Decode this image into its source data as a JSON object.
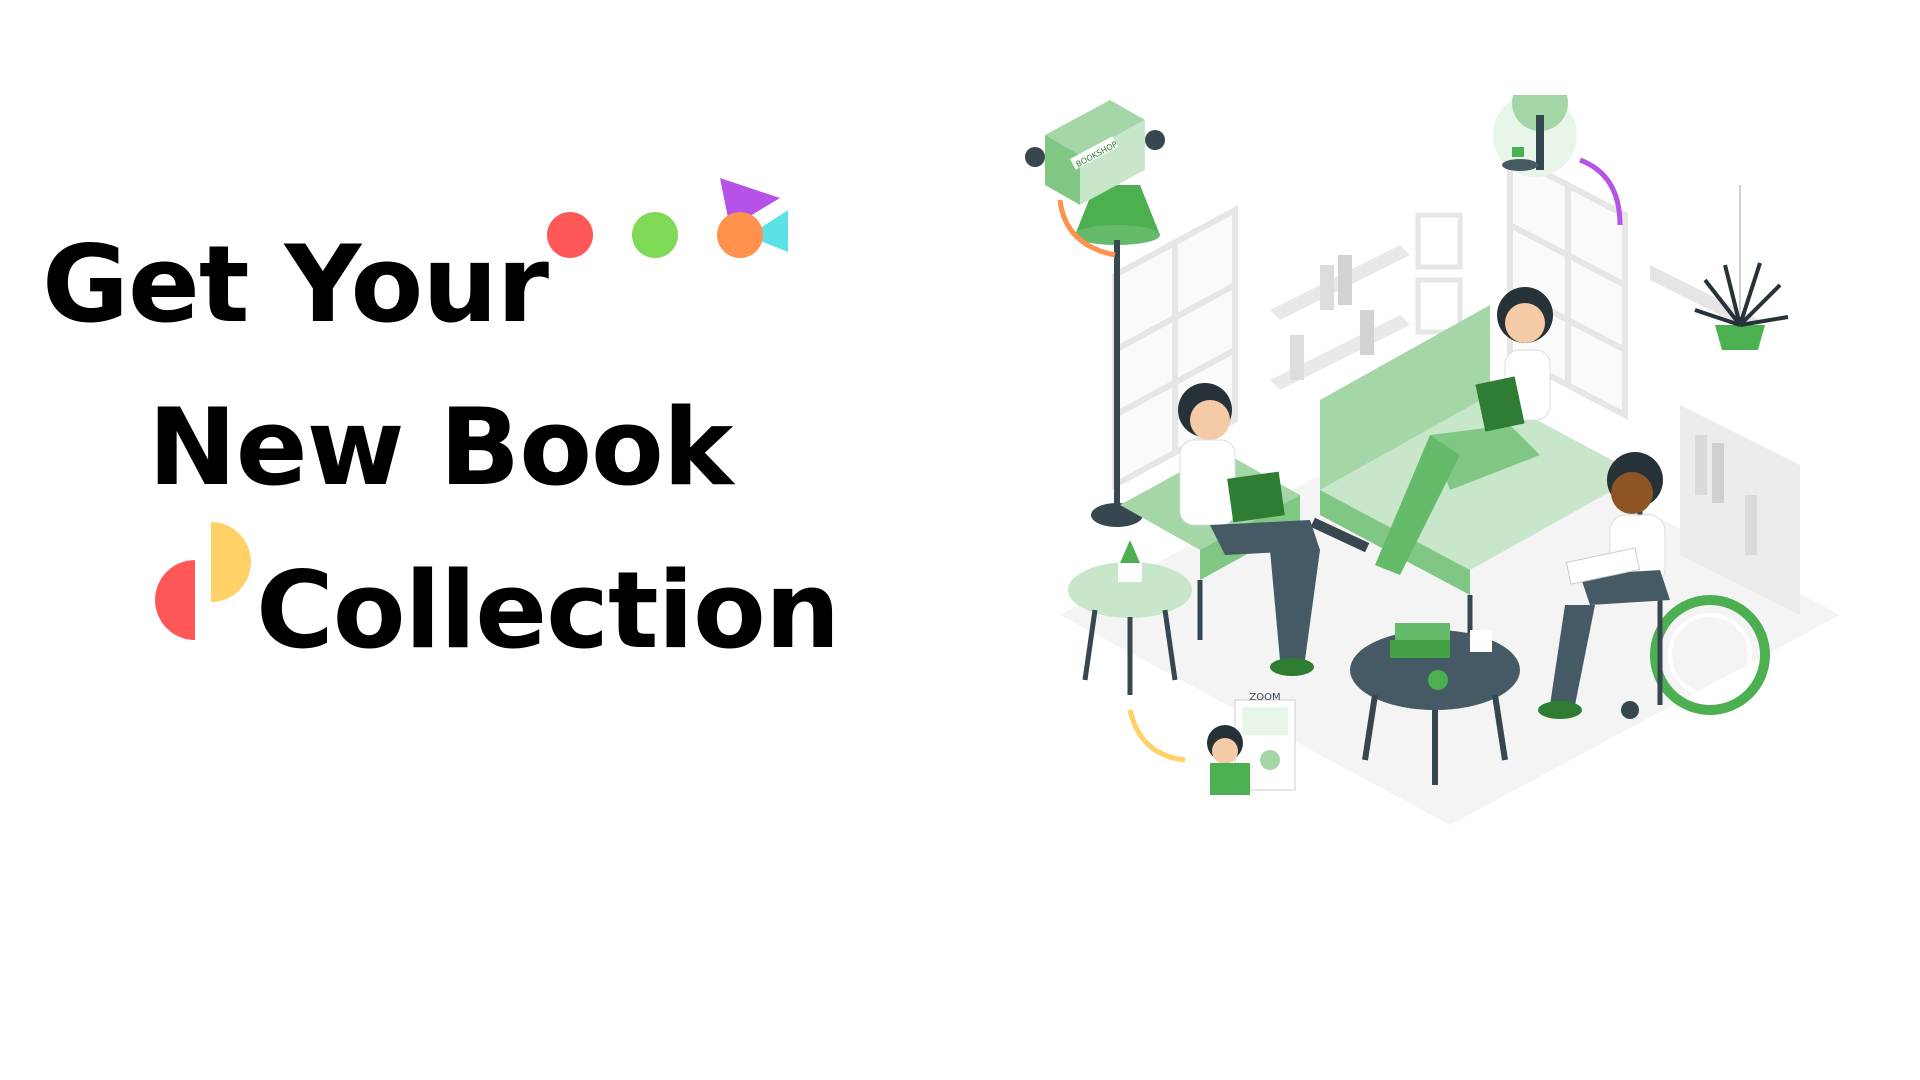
{
  "headline": {
    "line1": "Get Your",
    "line2": "New Book",
    "line3": "Collection"
  },
  "illustration": {
    "bookshop_sign": "BOOKSHOP",
    "comic_sign": "ZOOM"
  },
  "colors": {
    "text": "#000000",
    "accent_red": "#FF5757",
    "accent_green": "#7ED957",
    "accent_orange": "#FF914D",
    "accent_purple": "#B552E8",
    "accent_cyan": "#5CE1E6",
    "accent_yellow": "#FFD166",
    "illustration_green": "#4CAF50",
    "illustration_light_green": "#A5D6A7",
    "illustration_dark": "#37474F"
  },
  "icons": [
    "red-dot-icon",
    "green-dot-icon",
    "orange-dot-icon",
    "purple-triangle-icon",
    "cyan-triangle-icon",
    "red-half-circle-icon",
    "yellow-half-circle-icon"
  ]
}
